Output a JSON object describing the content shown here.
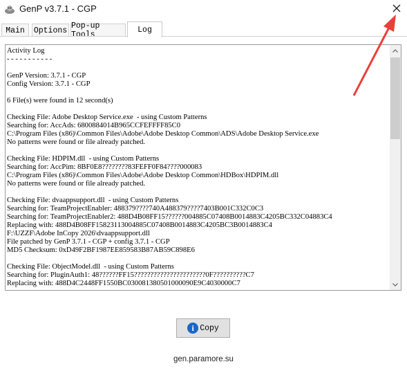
{
  "window": {
    "title": "GenP v3.7.1 - CGP"
  },
  "tabs": [
    {
      "label": "Main"
    },
    {
      "label": "Options"
    },
    {
      "label": "Pop-up Tools"
    },
    {
      "label": "Log"
    }
  ],
  "active_tab": "Log",
  "log": {
    "lines": [
      "Activity Log",
      "- - - - - - - - - - -",
      "",
      "GenP Version: 3.7.1 - CGP",
      "Config Version: 3.7.1 - CGP",
      "",
      "6 File(s) were found in 12 second(s)",
      "",
      "Checking File: Adobe Desktop Service.exe  - using Custom Patterns",
      "Searching for: AccAds: 6800884014B965CCFEFFFF85C0",
      "C:\\Program Files (x86)\\Common Files\\Adobe\\Adobe Desktop Common\\ADS\\Adobe Desktop Service.exe",
      "No patterns were found or file already patched.",
      "",
      "Checking File: HDPIM.dll  - using Custom Patterns",
      "Searching for: AccPim: 8BF0E8????????83FEFF0F84????000083",
      "C:\\Program Files (x86)\\Common Files\\Adobe\\Adobe Desktop Common\\HDBox\\HDPIM.dll",
      "No patterns were found or file already patched.",
      "",
      "Checking File: dvaappsupport.dll  - using Custom Patterns",
      "Searching for: TeamProjectEnabler: 488379????740A488379????7403B001C332C0C3",
      "Searching for: TeamProjectEnabler2: 488D4B08FF15??????004885C07408B0014883C4205BC332C04883C4",
      "Replacing with: 488D4B08FF15823113004885C07408B0014883C4205BC3B0014883C4",
      "F:\\UZZF\\Adobe InCopy 2026\\dvaappsupport.dll",
      "File patched by GenP 3.7.1 - CGP + config 3.7.1 - CGP",
      "MD5 Checksum: 0xD49F2BF1987EE859583B87AB59C898E6",
      "",
      "Checking File: ObjectModel.dll  - using Custom Patterns",
      "Searching for: PluginAuth1: 48??????FF15??????????????????????0F??????????C7",
      "Replacing with: 488D4C2448FF1550BC030081380501000090E9C4030000C7"
    ]
  },
  "buttons": {
    "copy_label": "Copy"
  },
  "footer": {
    "link_text": "gen.paramore.su"
  },
  "colors": {
    "annotation_arrow": "#e8403a",
    "copy_info_icon": "#1a66c9"
  }
}
